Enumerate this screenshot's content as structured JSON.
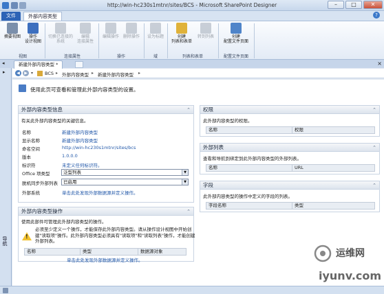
{
  "window": {
    "title": "http://win-hc230s1mtnr/sites/BCS - Microsoft SharePoint Designer",
    "minimize": "–",
    "maximize": "□",
    "close": "✕"
  },
  "ribbon_tabs": {
    "file": "文件",
    "external_content_types": "外部内容类型"
  },
  "ribbon": {
    "summary_view": "摘要视图",
    "operations_design_view": "操作\n设计视图",
    "group_views": "视图",
    "switch_system": "切换已连接的\n系统",
    "edit_connection": "编辑\n连接属性",
    "group_connection": "连接属性",
    "edit_operation": "编辑操作",
    "delete_operation": "删除操作",
    "group_operations": "操作",
    "set_as_title": "设为标题",
    "group_field": "域",
    "create_lists_forms": "创建\n列表和表单",
    "go_to_list": "转到列表",
    "group_lists_forms": "列表和表单",
    "create_profile_page": "创建\n配置文件页面",
    "group_profile_page": "配置文件页面"
  },
  "left_nav": {
    "label": "导航"
  },
  "doc_tab": {
    "label": "新建外部内容类型 *"
  },
  "breadcrumb": {
    "items": [
      "BCS",
      "外部内容类型",
      "新建外部内容类型"
    ]
  },
  "intro": "使用此页可查看和管理此外部内容类型的设置。",
  "info_panel": {
    "title": "外部内容类型信息",
    "description": "有关此外部内容类型的关键信息。",
    "fields": [
      {
        "label": "名称",
        "value": "新建外部内容类型"
      },
      {
        "label": "显示名称",
        "value": "新建外部内容类型"
      },
      {
        "label": "命名空间",
        "value": "http://win-hc230s1mtnr/sites/bcs"
      },
      {
        "label": "版本",
        "value": "1.0.0.0"
      },
      {
        "label": "标识符",
        "value": "未定义任何标识符。"
      }
    ],
    "office_type_label": "Office 项类型",
    "office_type_value": "泛型列表",
    "offline_sync_label": "脱机同步外部列表",
    "offline_sync_value": "已启用",
    "external_system_label": "外部系统",
    "external_system_value": "单击此处发现外部数据源并定义操作。"
  },
  "operations_panel": {
    "title": "外部内容类型操作",
    "description": "使用此部件可管理此外部内容类型的操作。",
    "warning": "必须至少定义一个操作，才能保存此外部内容类型。请从操作设计视图中开始创建\"读取项\"操作。此外部内容类型必须具有\"读取项\"和\"读取列表\"操作，才能创建外部列表。",
    "columns": [
      "名称",
      "类型",
      "数据源对象"
    ],
    "link": "单击此处发现外部数据源并定义操作。"
  },
  "permissions_panel": {
    "title": "权限",
    "description": "此外部内容类型的权限。",
    "columns": [
      "名称",
      "权限"
    ]
  },
  "external_lists_panel": {
    "title": "外部列表",
    "description": "查看和导航到绑定到此外部内容类型的外部列表。",
    "columns": [
      "名称",
      "URL"
    ]
  },
  "fields_panel": {
    "title": "字段",
    "description": "此外部内容类型的操作中定义的字段的列表。",
    "columns": [
      "字段名称",
      "类型"
    ]
  },
  "watermark": {
    "text1": "运维网",
    "text2": "iyunv.com"
  }
}
